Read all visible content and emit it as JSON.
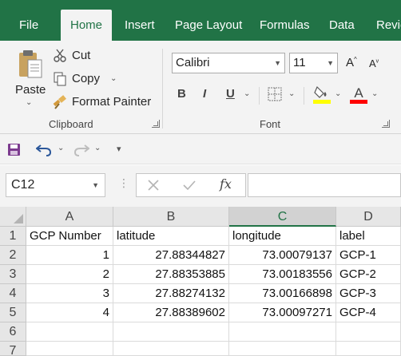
{
  "ribbon_tabs": [
    "File",
    "Home",
    "Insert",
    "Page Layout",
    "Formulas",
    "Data",
    "Revie"
  ],
  "clipboard": {
    "paste_label": "Paste",
    "cut_label": "Cut",
    "copy_label": "Copy",
    "format_painter_label": "Format Painter",
    "group_label": "Clipboard"
  },
  "font": {
    "name": "Calibri",
    "size": "11",
    "group_label": "Font",
    "bold": "B",
    "italic": "I",
    "underline": "U"
  },
  "name_box": "C12",
  "fx_label": "fx",
  "columns": [
    "A",
    "B",
    "C",
    "D"
  ],
  "rows": [
    {
      "num": "1",
      "cells": [
        "GCP Number",
        "latitude",
        "longitude",
        "label"
      ]
    },
    {
      "num": "2",
      "cells": [
        "1",
        "27.88344827",
        "73.00079137",
        "GCP-1"
      ]
    },
    {
      "num": "3",
      "cells": [
        "2",
        "27.88353885",
        "73.00183556",
        "GCP-2"
      ]
    },
    {
      "num": "4",
      "cells": [
        "3",
        "27.88274132",
        "73.00166898",
        "GCP-3"
      ]
    },
    {
      "num": "5",
      "cells": [
        "4",
        "27.88389602",
        "73.00097271",
        "GCP-4"
      ]
    },
    {
      "num": "6",
      "cells": [
        "",
        "",
        "",
        ""
      ]
    },
    {
      "num": "7",
      "cells": [
        "",
        "",
        "",
        ""
      ]
    }
  ],
  "colors": {
    "excel_green": "#217346",
    "highlight_yellow": "#ffff00",
    "font_red": "#ff0000"
  }
}
